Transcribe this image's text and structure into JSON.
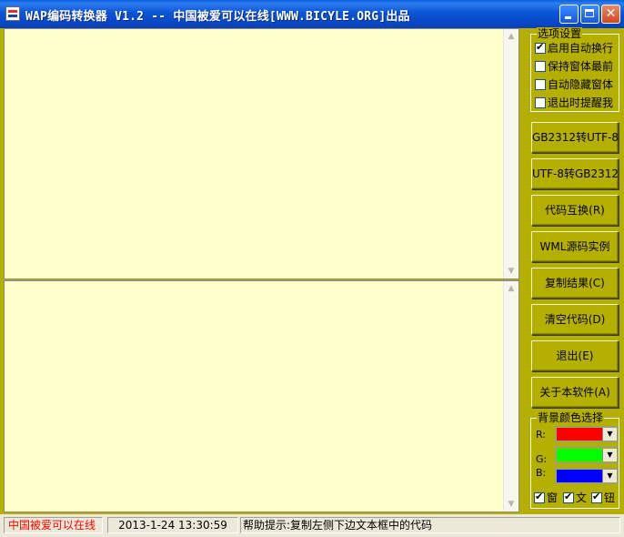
{
  "window": {
    "title": "WAP编码转换器 V1.2  -- 中国被爱可以在线[WWW.BICYLE.ORG]出品"
  },
  "titlebar_buttons": {
    "minimize": "_",
    "maximize": "□",
    "close": "✕"
  },
  "options": {
    "legend": "选项设置",
    "items": [
      {
        "label": "启用自动换行",
        "checked": true
      },
      {
        "label": "保持窗体最前",
        "checked": false
      },
      {
        "label": "自动隐藏窗体",
        "checked": false
      },
      {
        "label": "退出时提醒我",
        "checked": false
      }
    ]
  },
  "buttons": {
    "gb_to_utf8": "GB2312转UTF-8",
    "utf8_to_gb": "UTF-8转GB2312",
    "code_swap": "代码互换(R)",
    "wml_example": "WML源码实例",
    "copy_result": "复制结果(C)",
    "clear_code": "清空代码(D)",
    "exit": "退出(E)",
    "about": "关于本软件(A)"
  },
  "bgcolor": {
    "legend": "背景颜色选择",
    "r_label": "R:",
    "g_label": "G:",
    "b_label": "B:",
    "r_color": "#FF0000",
    "g_color": "#00FF00",
    "b_color": "#0000FF",
    "target_window": "窗",
    "target_text": "文",
    "target_button": "钮"
  },
  "status": {
    "site": "中国被爱可以在线",
    "datetime": "2013-1-24 13:30:59",
    "help": "帮助提示:复制左侧下边文本框中的代码"
  },
  "colors": {
    "pane_bg": "#FFFFCC",
    "panel_bg": "#B5B000",
    "site_text": "#FF0000"
  }
}
